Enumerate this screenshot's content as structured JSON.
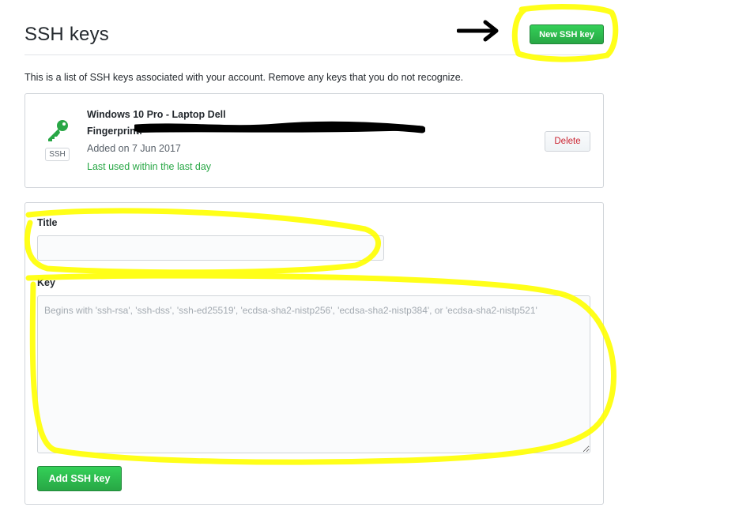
{
  "header": {
    "title": "SSH keys",
    "new_key_button": "New SSH key"
  },
  "lead_text": "This is a list of SSH keys associated with your account. Remove any keys that you do not recognize.",
  "keys": [
    {
      "name": "Windows 10 Pro - Laptop Dell",
      "fingerprint_label": "Fingerprint:",
      "badge": "SSH",
      "added": "Added on 7 Jun 2017",
      "last_used": "Last used within the last day",
      "delete_label": "Delete"
    }
  ],
  "form": {
    "title_label": "Title",
    "title_value": "",
    "key_label": "Key",
    "key_placeholder": "Begins with 'ssh-rsa', 'ssh-dss', 'ssh-ed25519', 'ecdsa-sha2-nistp256', 'ecdsa-sha2-nistp384', or 'ecdsa-sha2-nistp521'",
    "submit_label": "Add SSH key"
  },
  "colors": {
    "accent_green": "#28a745",
    "danger_red": "#cb2431",
    "highlight_yellow": "#ffff00",
    "border": "#d1d5da"
  },
  "icons": [
    "key-icon",
    "arrow-right-icon"
  ]
}
